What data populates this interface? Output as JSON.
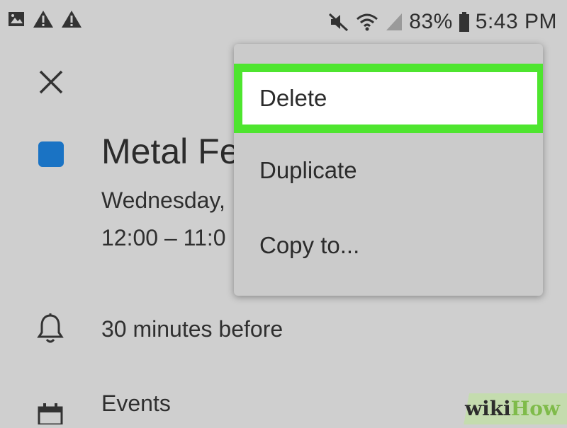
{
  "status_bar": {
    "battery_percent": "83%",
    "time": "5:43 PM",
    "left_icons": [
      "image-icon",
      "warning-icon",
      "warning-icon"
    ],
    "right_icons": [
      "mute-icon",
      "wifi-icon",
      "signal-icon",
      "battery-icon"
    ]
  },
  "event": {
    "color": "#1a73c4",
    "title": "Metal Fe",
    "date": "Wednesday,",
    "time": "12:00 – 11:0",
    "reminder": "30 minutes before",
    "calendar": "Events"
  },
  "menu": {
    "items": [
      {
        "label": "Delete",
        "highlighted": true,
        "highlight_color": "#4ee52f"
      },
      {
        "label": "Duplicate"
      },
      {
        "label": "Copy to..."
      }
    ]
  },
  "watermark": {
    "part1": "wiki",
    "part2": "How"
  }
}
